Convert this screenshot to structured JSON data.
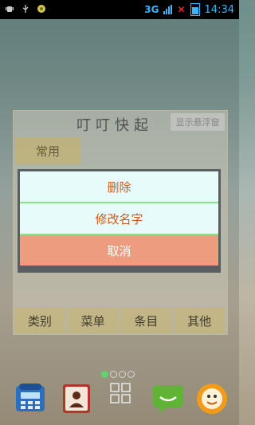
{
  "status_bar": {
    "network": "3G",
    "time": "14:34",
    "notification_count": "2",
    "battery_level": "5"
  },
  "app": {
    "title": "叮叮快起",
    "float_toggle": "显示悬浮窗",
    "tab_common": "常用",
    "bottom_tabs": [
      "类别",
      "菜单",
      "条目",
      "其他"
    ]
  },
  "dialog": {
    "delete": "删除",
    "rename": "修改名字",
    "cancel": "取消"
  },
  "launcher": {
    "page_count": 4,
    "current_page": 1,
    "dock_icons": [
      "phone-icon",
      "contacts-icon",
      "app-drawer-icon",
      "sms-icon",
      "browser-icon"
    ]
  },
  "colors": {
    "dialog_text": "#d05a1c",
    "dialog_row_bg": "#e7fbfb",
    "dialog_cancel_bg": "#ee9c7f",
    "divider": "#8fe08a",
    "status_accent": "#39b6ff"
  }
}
